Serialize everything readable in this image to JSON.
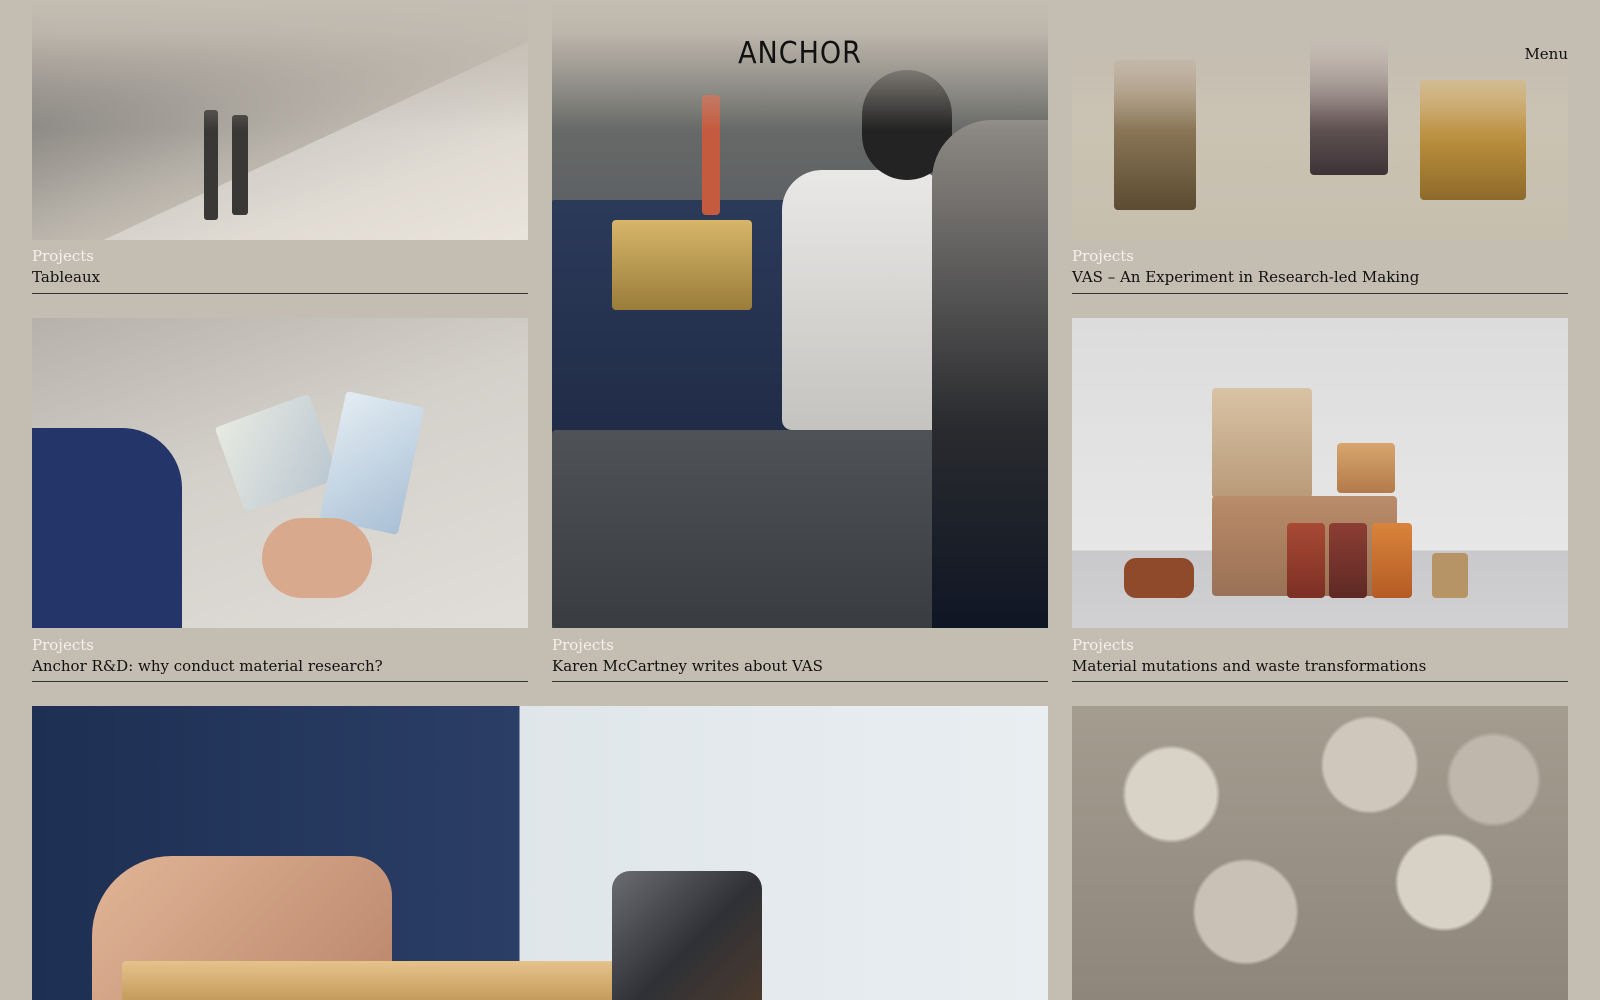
{
  "header": {
    "logo": "ANCHOR",
    "menu_label": "Menu"
  },
  "cards": [
    {
      "category": "Projects",
      "title": "Tableaux"
    },
    {
      "category": "Projects",
      "title": "VAS – An Experiment in Research-led Making"
    },
    {
      "category": "Projects",
      "title": "Anchor R&D: why conduct material research?"
    },
    {
      "category": "Projects",
      "title": "Karen McCartney writes about VAS"
    },
    {
      "category": "Projects",
      "title": "Material mutations and waste transformations"
    }
  ],
  "colors": {
    "background": "#c4bdb2",
    "text": "#111111",
    "category_text": "#f4f1ec"
  }
}
